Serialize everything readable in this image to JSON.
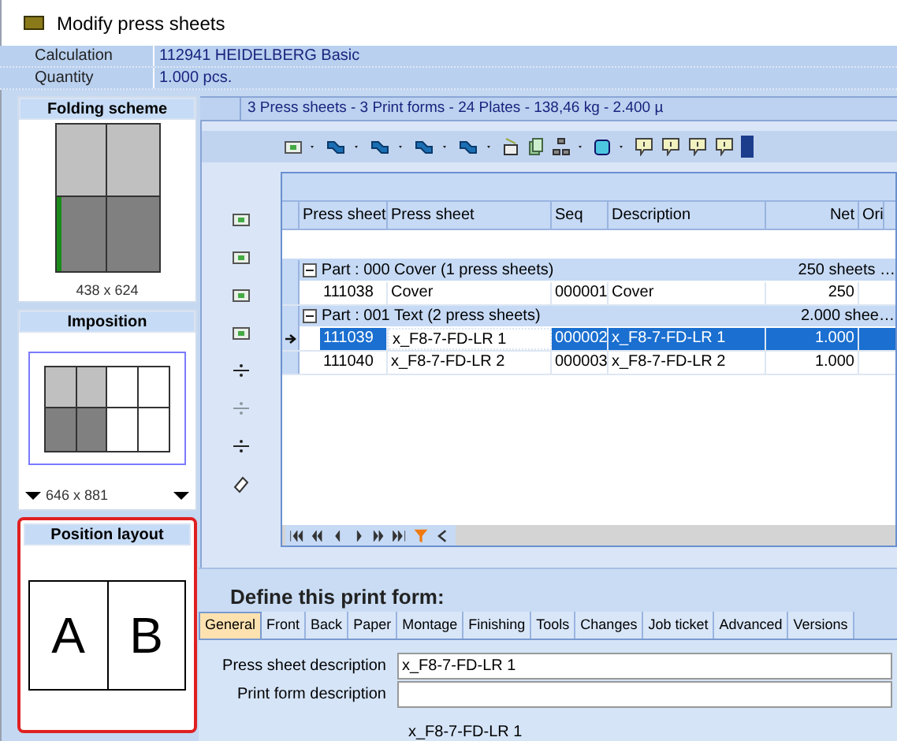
{
  "window": {
    "title": "Modify press sheets"
  },
  "info": [
    {
      "label": "Calculation",
      "value": "112941 HEIDELBERG Basic"
    },
    {
      "label": "Quantity",
      "value": "1.000 pcs."
    }
  ],
  "folding_scheme": {
    "title": "Folding scheme",
    "size": "438 x 624"
  },
  "imposition": {
    "title": "Imposition",
    "size": "646 x 881"
  },
  "position_layout": {
    "title": "Position layout",
    "pages": [
      "A",
      "B"
    ]
  },
  "summary": "3 Press sheets - 3 Print forms - 24 Plates - 138,46 kg - 2.400 µ",
  "table": {
    "columns": [
      "Press sheet",
      "Press sheet",
      "Seq",
      "Description",
      "Net",
      "Ori"
    ],
    "groups": [
      {
        "label": "Part : 000 Cover (1 press sheets)",
        "total": "250 sheets …",
        "expanded": true,
        "rows": [
          {
            "cells": [
              "111038",
              "Cover",
              "000001",
              "Cover",
              "250"
            ],
            "selected": false
          }
        ]
      },
      {
        "label": "Part : 001 Text (2 press sheets)",
        "total": "2.000 shee…",
        "expanded": true,
        "rows": [
          {
            "cells": [
              "111039",
              "x_F8-7-FD-LR 1",
              "000002",
              "x_F8-7-FD-LR 1",
              "1.000"
            ],
            "selected": true
          },
          {
            "cells": [
              "111040",
              "x_F8-7-FD-LR 2",
              "000003",
              "x_F8-7-FD-LR 2",
              "1.000"
            ],
            "selected": false
          }
        ]
      }
    ]
  },
  "form": {
    "title": "Define this print form:",
    "tabs": [
      {
        "label": "General",
        "selected": true
      },
      {
        "label": "Front",
        "selected": false
      },
      {
        "label": "Back",
        "selected": false
      },
      {
        "label": "Paper",
        "selected": false
      },
      {
        "label": "Montage",
        "selected": false
      },
      {
        "label": "Finishing",
        "selected": false
      },
      {
        "label": "Tools",
        "selected": false
      },
      {
        "label": "Changes",
        "selected": false
      },
      {
        "label": "Job ticket",
        "selected": false
      },
      {
        "label": "Advanced",
        "selected": false
      },
      {
        "label": "Versions",
        "selected": false
      }
    ],
    "fields": [
      {
        "label": "Press sheet description",
        "value": "x_F8-7-FD-LR 1"
      },
      {
        "label": "Print form description"
      }
    ],
    "note": "x_F8-7-FD-LR 1"
  }
}
